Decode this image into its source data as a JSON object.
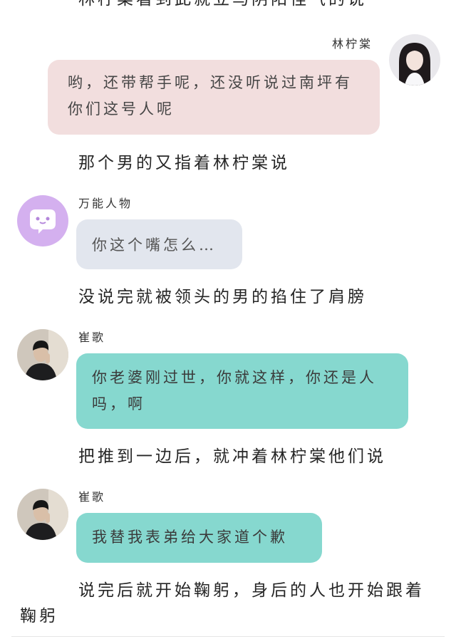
{
  "narration": [
    "林柠棠看到此就立马阴阳怪气的说",
    "那个男的又指着林柠棠说",
    "没说完就被领头的男的掐住了肩膀",
    "把推到一边后，就冲着林柠棠他们说",
    "说完后就开始鞠躬，身后的人也开始跟着鞠躬"
  ],
  "messages": [
    {
      "sender": "林柠棠",
      "side": "right",
      "avatar_icon": "girl-portrait-icon",
      "text": "哟，还带帮手呢，还没听说过南坪有你们这号人呢",
      "color": "#f2dede"
    },
    {
      "sender": "万能人物",
      "side": "left",
      "avatar_icon": "chat-bubble-face-icon",
      "text": "你这个嘴怎么…",
      "color": "#e2e6ee"
    },
    {
      "sender": "崔歌",
      "side": "left",
      "avatar_icon": "man-portrait-icon",
      "text": "你老婆刚过世，你就这样，你还是人吗，啊",
      "color": "#86d8cf"
    },
    {
      "sender": "崔歌",
      "side": "left",
      "avatar_icon": "man-portrait-icon",
      "text": "我替我表弟给大家道个歉",
      "color": "#86d8cf"
    }
  ]
}
